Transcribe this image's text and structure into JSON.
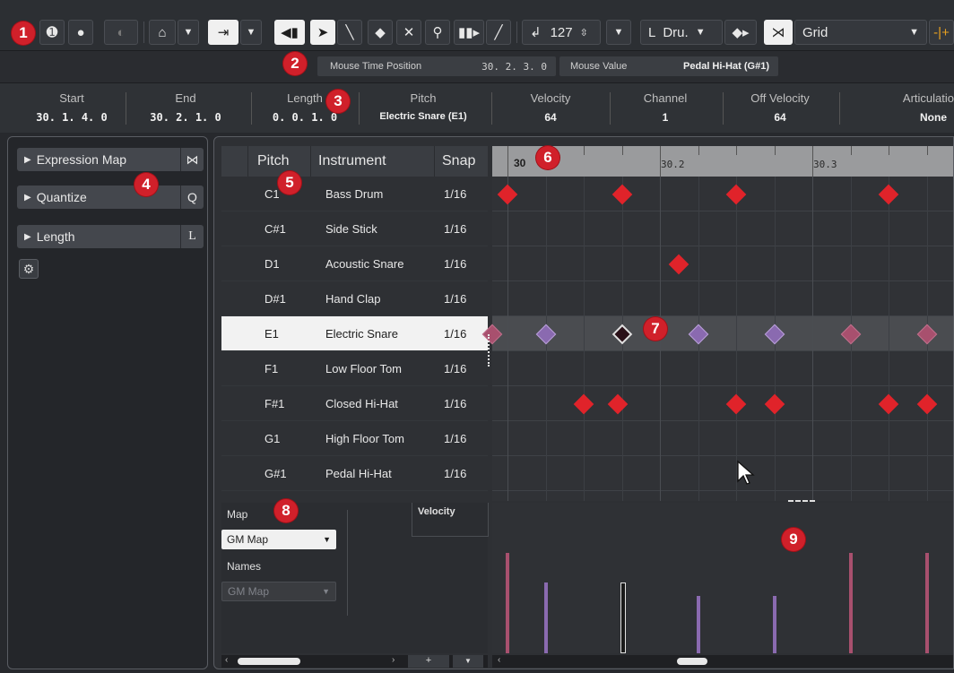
{
  "toolbar": {
    "quantize_label": "Grid",
    "velocity_value": "127",
    "drum_label": "Dru."
  },
  "infoline": {
    "mouse_time_label": "Mouse Time Position",
    "mouse_time_value": "30. 2. 3.   0",
    "mouse_value_label": "Mouse Value",
    "mouse_value_value": "Pedal Hi-Hat (G#1)"
  },
  "status": {
    "start_label": "Start",
    "start_value": "30. 1. 4.   0",
    "end_label": "End",
    "end_value": "30. 2. 1.   0",
    "length_label": "Length",
    "length_value": "0. 0. 1.   0",
    "pitch_label": "Pitch",
    "pitch_value": "Electric Snare (E1)",
    "velocity_label": "Velocity",
    "velocity_value": "64",
    "channel_label": "Channel",
    "channel_value": "1",
    "offvel_label": "Off Velocity",
    "offvel_value": "64",
    "artic_label": "Articulatio",
    "artic_value": "None"
  },
  "inspector": {
    "sections": [
      "Expression Map",
      "Quantize",
      "Length"
    ],
    "quantize_key": "Q",
    "length_key": "L"
  },
  "drum_list": {
    "headers": {
      "pitch": "Pitch",
      "instrument": "Instrument",
      "snap": "Snap"
    },
    "rows": [
      {
        "pitch": "C1",
        "instrument": "Bass Drum",
        "snap": "1/16"
      },
      {
        "pitch": "C#1",
        "instrument": "Side Stick",
        "snap": "1/16"
      },
      {
        "pitch": "D1",
        "instrument": "Acoustic Snare",
        "snap": "1/16"
      },
      {
        "pitch": "D#1",
        "instrument": "Hand Clap",
        "snap": "1/16"
      },
      {
        "pitch": "E1",
        "instrument": "Electric Snare",
        "snap": "1/16"
      },
      {
        "pitch": "F1",
        "instrument": "Low Floor Tom",
        "snap": "1/16"
      },
      {
        "pitch": "F#1",
        "instrument": "Closed Hi-Hat",
        "snap": "1/16"
      },
      {
        "pitch": "G1",
        "instrument": "High Floor Tom",
        "snap": "1/16"
      },
      {
        "pitch": "G#1",
        "instrument": "Pedal Hi-Hat",
        "snap": "1/16"
      }
    ],
    "selected_row": "E1"
  },
  "ruler": {
    "labels": [
      "30",
      "30.2",
      "30.3"
    ]
  },
  "lower": {
    "map_label": "Map",
    "map_value": "GM Map",
    "names_label": "Names",
    "names_value": "GM Map",
    "velocity_label": "Velocity"
  },
  "markers": [
    "1",
    "2",
    "3",
    "4",
    "5",
    "6",
    "7",
    "8",
    "9"
  ],
  "colors": {
    "note_red": "#e0232a",
    "note_purple": "#8a6ab0",
    "note_pink": "#a8506e",
    "marker_red": "#d0202a"
  }
}
